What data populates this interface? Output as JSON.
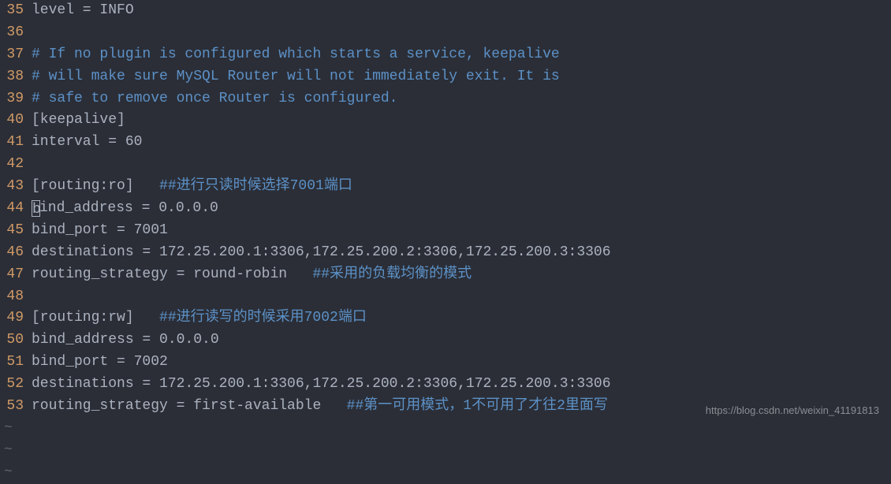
{
  "lines": [
    {
      "num": "35",
      "segments": [
        {
          "cls": "code",
          "text": "level = INFO"
        }
      ]
    },
    {
      "num": "36",
      "segments": []
    },
    {
      "num": "37",
      "segments": [
        {
          "cls": "comment",
          "text": "# If no plugin is configured which starts a service, keepalive"
        }
      ]
    },
    {
      "num": "38",
      "segments": [
        {
          "cls": "comment",
          "text": "# will make sure MySQL Router will not immediately exit. It is"
        }
      ]
    },
    {
      "num": "39",
      "segments": [
        {
          "cls": "comment",
          "text": "# safe to remove once Router is configured."
        }
      ]
    },
    {
      "num": "40",
      "segments": [
        {
          "cls": "code",
          "text": "[keepalive]"
        }
      ]
    },
    {
      "num": "41",
      "segments": [
        {
          "cls": "code",
          "text": "interval = 60"
        }
      ]
    },
    {
      "num": "42",
      "segments": []
    },
    {
      "num": "43",
      "segments": [
        {
          "cls": "code",
          "text": "[routing:ro]   "
        },
        {
          "cls": "comment",
          "text": "##进行只读时候选择7001端口"
        }
      ]
    },
    {
      "num": "44",
      "cursor": true,
      "cursorChar": "b",
      "segments": [
        {
          "cls": "code",
          "text": "ind_address = 0.0.0.0"
        }
      ]
    },
    {
      "num": "45",
      "segments": [
        {
          "cls": "code",
          "text": "bind_port = 7001"
        }
      ]
    },
    {
      "num": "46",
      "segments": [
        {
          "cls": "code",
          "text": "destinations = 172.25.200.1:3306,172.25.200.2:3306,172.25.200.3:3306"
        }
      ]
    },
    {
      "num": "47",
      "segments": [
        {
          "cls": "code",
          "text": "routing_strategy = round-robin   "
        },
        {
          "cls": "comment",
          "text": "##采用的负载均衡的模式"
        }
      ]
    },
    {
      "num": "48",
      "segments": []
    },
    {
      "num": "49",
      "segments": [
        {
          "cls": "code",
          "text": "[routing:rw]   "
        },
        {
          "cls": "comment",
          "text": "##进行读写的时候采用7002端口"
        }
      ]
    },
    {
      "num": "50",
      "segments": [
        {
          "cls": "code",
          "text": "bind_address = 0.0.0.0"
        }
      ]
    },
    {
      "num": "51",
      "segments": [
        {
          "cls": "code",
          "text": "bind_port = 7002"
        }
      ]
    },
    {
      "num": "52",
      "segments": [
        {
          "cls": "code",
          "text": "destinations = 172.25.200.1:3306,172.25.200.2:3306,172.25.200.3:3306"
        }
      ]
    },
    {
      "num": "53",
      "segments": [
        {
          "cls": "code",
          "text": "routing_strategy = first-available   "
        },
        {
          "cls": "comment",
          "text": "##第一可用模式，1不可用了才往2里面写"
        }
      ]
    }
  ],
  "tildes": [
    "~",
    "~",
    "~"
  ],
  "watermark": "https://blog.csdn.net/weixin_41191813"
}
